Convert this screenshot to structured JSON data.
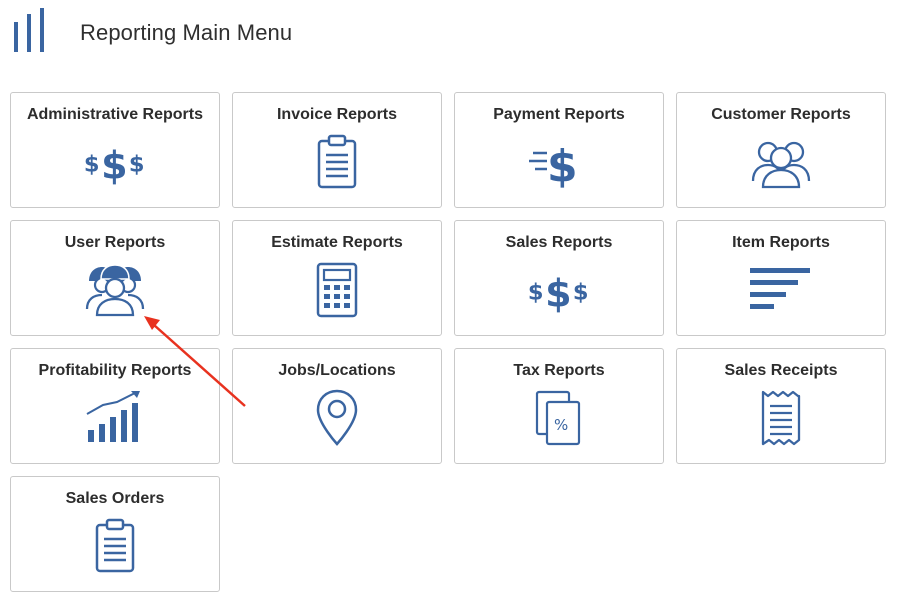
{
  "header": {
    "title": "Reporting Main Menu",
    "logo_icon": "bar-chart-icon"
  },
  "colors": {
    "icon": "#3a65a1",
    "tile_border": "#c9c9c9",
    "annotation_arrow": "#e8321f"
  },
  "tiles": [
    {
      "label": "Administrative Reports",
      "icon": "triple-dollar-icon"
    },
    {
      "label": "Invoice Reports",
      "icon": "clipboard-icon"
    },
    {
      "label": "Payment Reports",
      "icon": "fast-dollar-icon"
    },
    {
      "label": "Customer Reports",
      "icon": "users-group-icon"
    },
    {
      "label": "User Reports",
      "icon": "workers-icon"
    },
    {
      "label": "Estimate Reports",
      "icon": "calculator-icon"
    },
    {
      "label": "Sales Reports",
      "icon": "triple-dollar-icon"
    },
    {
      "label": "Item Reports",
      "icon": "list-bars-icon"
    },
    {
      "label": "Profitability Reports",
      "icon": "growth-chart-icon"
    },
    {
      "label": "Jobs/Locations",
      "icon": "map-pin-icon"
    },
    {
      "label": "Tax Reports",
      "icon": "percent-document-icon"
    },
    {
      "label": "Sales Receipts",
      "icon": "receipt-icon"
    },
    {
      "label": "Sales Orders",
      "icon": "clipboard-icon"
    }
  ]
}
